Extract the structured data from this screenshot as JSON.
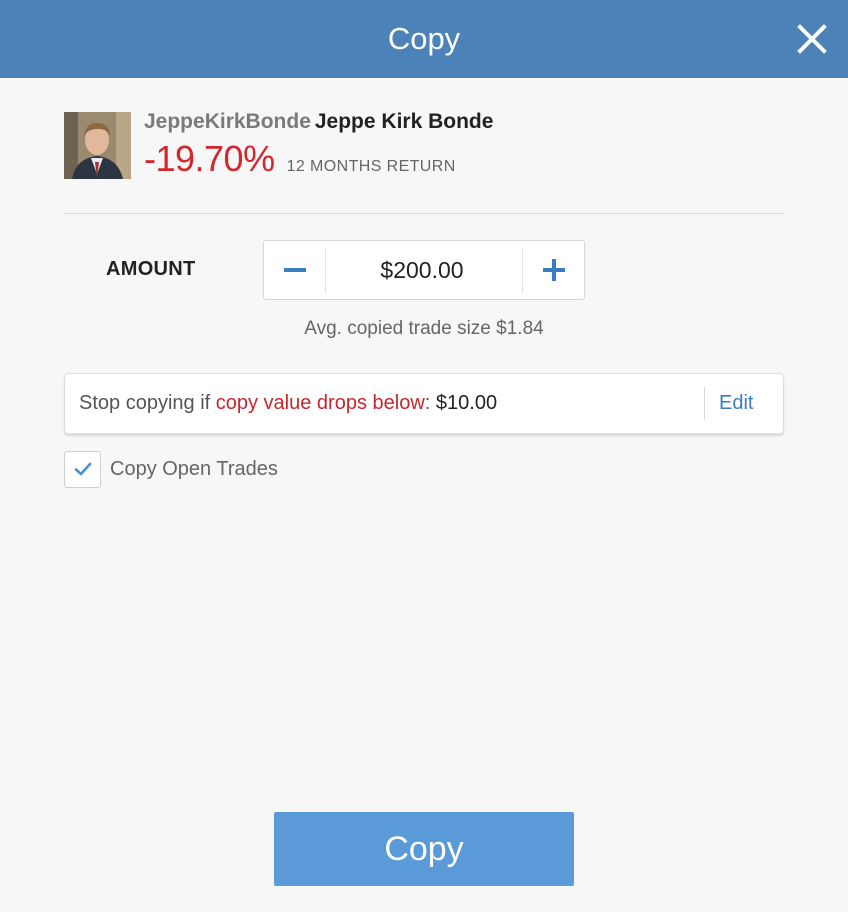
{
  "header": {
    "title": "Copy"
  },
  "trader": {
    "username": "JeppeKirkBonde",
    "full_name": "Jeppe Kirk Bonde",
    "return_value": "-19.70%",
    "return_label": "12 MONTHS RETURN"
  },
  "amount": {
    "label": "AMOUNT",
    "value": "$200.00",
    "avg_trade_size": "Avg. copied trade size $1.84"
  },
  "stop_loss": {
    "prefix": "Stop copying if ",
    "link_text": "copy value drops below",
    "separator": ": ",
    "value": "$10.00",
    "edit_label": "Edit"
  },
  "copy_open_trades": {
    "label": "Copy Open Trades",
    "checked": true
  },
  "footer": {
    "copy_button_label": "Copy"
  },
  "colors": {
    "header_bg": "#4b82b8",
    "negative_return": "#d4262c",
    "link_blue": "#3a7dc0",
    "button_blue": "#5a9ad9"
  },
  "icons": {
    "close": "close-icon",
    "minus": "minus-icon",
    "plus": "plus-icon",
    "check": "checkmark-icon"
  }
}
